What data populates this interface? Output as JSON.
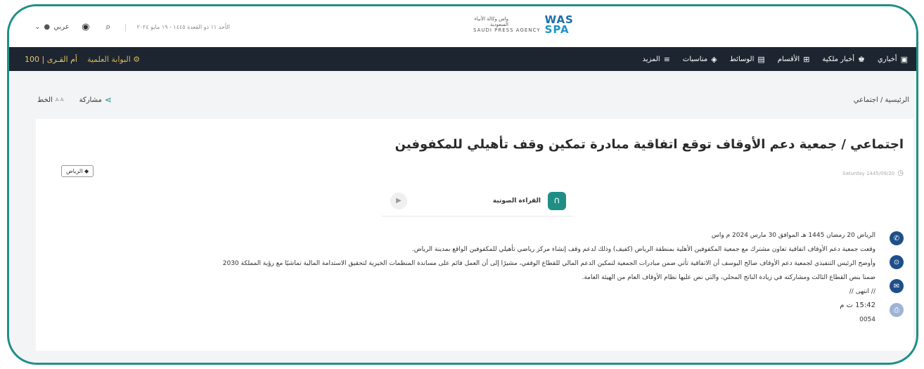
{
  "topbar": {
    "language": "عربي",
    "date_text": "الأحد ١١ ذو القعدة ١٤٤٥ - ١٩ مايو ٢٠٢٤",
    "logo_ar": "واس وكالة الأنباء السعودية",
    "logo_en": "SAUDI PRESS AGENCY",
    "logo_mark_top": "WAS",
    "logo_mark_bottom": "SPA"
  },
  "navbar": {
    "left_links": [
      "أم القـرى | 100",
      "البوابة العلمية"
    ],
    "items": [
      {
        "label": "أخباري",
        "icon": "news-icon"
      },
      {
        "label": "أخبار ملكية",
        "icon": "crown-icon"
      },
      {
        "label": "الأقسام",
        "icon": "grid-icon"
      },
      {
        "label": "الوسائط",
        "icon": "media-icon"
      },
      {
        "label": "مناسبات",
        "icon": "calendar-icon"
      },
      {
        "label": "المزيد",
        "icon": "menu-icon"
      }
    ]
  },
  "toolbar": {
    "share_label": "مشاركة",
    "font_label": "الخط",
    "font_glyph": "A A"
  },
  "breadcrumb": "الرئيسية / اجتماعي",
  "article": {
    "headline": "اجتماعي / جمعية دعم الأوقاف توقع اتفاقية مبادرة تمكين وقف تأهيلي للمكفوفين",
    "location": "الرياض",
    "timestamp": "Saturday 1445/09/20",
    "audio_label": "القراءة الصوتية",
    "paragraphs": [
      "الرياض 20 رمضان 1445 هـ الموافق 30 مارس 2024 م واس",
      "وقعت جمعية دعم الأوقاف اتفاقية تعاون مشترك مع جمعية المكفوفين الأهلية بمنطقة الرياض (كفيف) وذلك لدعم وقف إنشاء مركز رياضي تأهيلي للمكفوفين الواقع بمدينة الرياض.",
      "وأوضح الرئيس التنفيذي لجمعية دعم الأوقاف صالح اليوسف أن الاتفاقية تأتي ضمن مبادرات الجمعية لتمكين الدعم المالي للقطاع الوقفي، مشيرًا إلى أن العمل قائم على مساندة المنظمات الخيرية لتحقيق الاستدامة المالية تماشيًا مع رؤية المملكة 2030",
      "ضمنا بنص القطاع الثالث ومشاركته في زيادة الناتج المحلي، والتي نص عليها نظام الأوقاف العام من الهيئة العامة.",
      "// انتهى //"
    ],
    "time": "15:42 ت م",
    "code": "0054"
  },
  "colors": {
    "accent": "#1f8f86",
    "navbar_bg": "#1d2530",
    "gold": "#d7b45a",
    "social": "#1e4f8a"
  }
}
